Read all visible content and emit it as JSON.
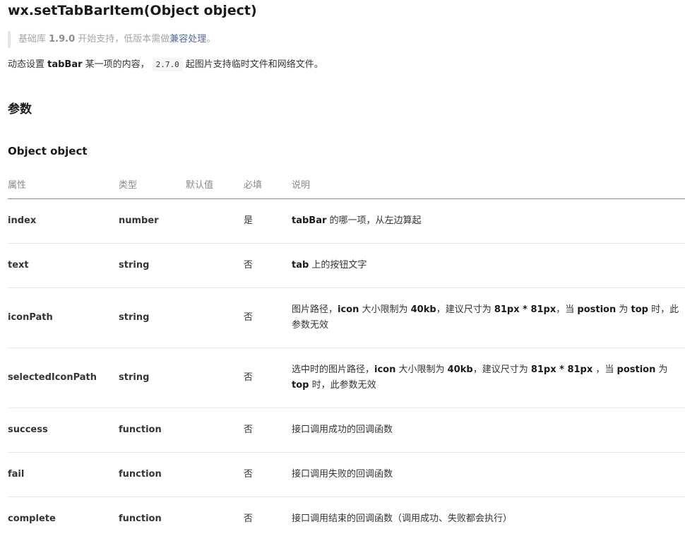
{
  "api": {
    "title": "wx.setTabBarItem(Object object)"
  },
  "notice": {
    "prefix": "基础库 ",
    "version": "1.9.0",
    "middle": " 开始支持，低版本需做",
    "link": "兼容处理",
    "suffix": "。"
  },
  "description": {
    "part1": "动态设置 ",
    "bold": "tabBar",
    "part2": " 某一项的内容，",
    "code": "2.7.0",
    "part3": "起图片支持临时文件和网络文件。"
  },
  "headings": {
    "params": "参数",
    "object": "Object object"
  },
  "table": {
    "headers": {
      "name": "属性",
      "type": "类型",
      "default": "默认值",
      "required": "必填",
      "description": "说明"
    },
    "rows": [
      {
        "name": "index",
        "type": "number",
        "default": "",
        "required": "是",
        "desc": [
          {
            "t": "tabBar",
            "b": true
          },
          {
            "t": " 的哪一项，从左边算起",
            "b": false
          }
        ]
      },
      {
        "name": "text",
        "type": "string",
        "default": "",
        "required": "否",
        "desc": [
          {
            "t": "tab",
            "b": true
          },
          {
            "t": " 上的按钮文字",
            "b": false
          }
        ]
      },
      {
        "name": "iconPath",
        "type": "string",
        "default": "",
        "required": "否",
        "desc": [
          {
            "t": "图片路径，",
            "b": false
          },
          {
            "t": "icon",
            "b": true
          },
          {
            "t": " 大小限制为 ",
            "b": false
          },
          {
            "t": "40kb",
            "b": true
          },
          {
            "t": "，建议尺寸为 ",
            "b": false
          },
          {
            "t": "81px * 81px",
            "b": true
          },
          {
            "t": "，当 ",
            "b": false
          },
          {
            "t": "postion",
            "b": true
          },
          {
            "t": " 为 ",
            "b": false
          },
          {
            "t": "top",
            "b": true
          },
          {
            "t": " 时，此参数无效",
            "b": false
          }
        ]
      },
      {
        "name": "selectedIconPath",
        "type": "string",
        "default": "",
        "required": "否",
        "desc": [
          {
            "t": "选中时的图片路径，",
            "b": false
          },
          {
            "t": "icon",
            "b": true
          },
          {
            "t": " 大小限制为 ",
            "b": false
          },
          {
            "t": "40kb",
            "b": true
          },
          {
            "t": "，建议尺寸为 ",
            "b": false
          },
          {
            "t": "81px * 81px",
            "b": true
          },
          {
            "t": " ，当 ",
            "b": false
          },
          {
            "t": "postion",
            "b": true
          },
          {
            "t": " 为 ",
            "b": false
          },
          {
            "t": "top",
            "b": true
          },
          {
            "t": " 时，此参数无效",
            "b": false
          }
        ]
      },
      {
        "name": "success",
        "type": "function",
        "default": "",
        "required": "否",
        "desc": [
          {
            "t": "接口调用成功的回调函数",
            "b": false
          }
        ]
      },
      {
        "name": "fail",
        "type": "function",
        "default": "",
        "required": "否",
        "desc": [
          {
            "t": "接口调用失败的回调函数",
            "b": false
          }
        ]
      },
      {
        "name": "complete",
        "type": "function",
        "default": "",
        "required": "否",
        "desc": [
          {
            "t": "接口调用结束的回调函数（调用成功、失败都会执行）",
            "b": false
          }
        ]
      }
    ]
  }
}
